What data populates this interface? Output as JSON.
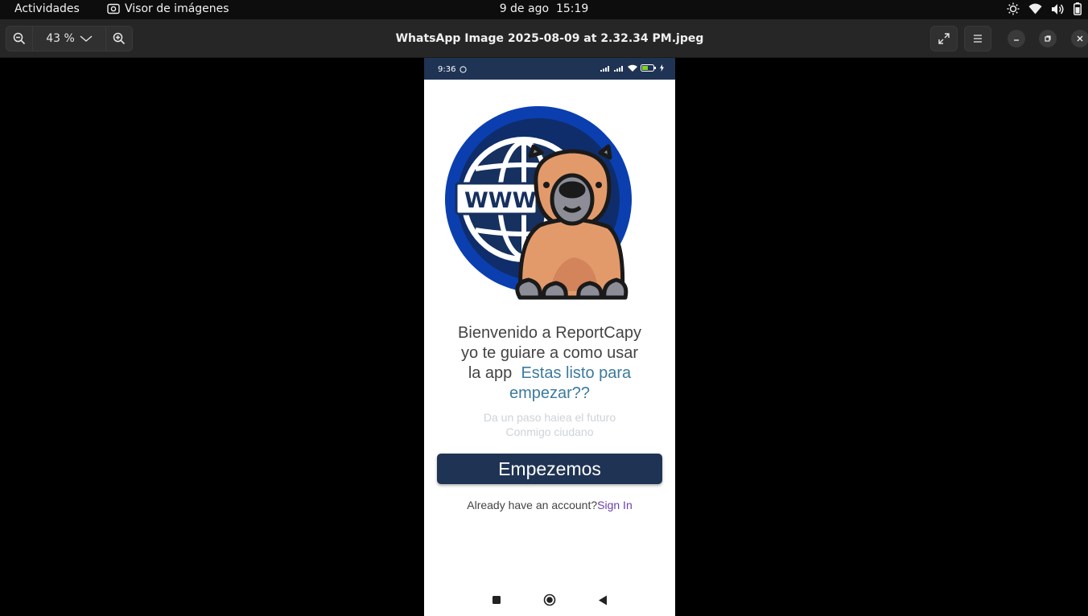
{
  "topbar": {
    "activities": "Actividades",
    "app_name": "Visor de imágenes",
    "date": "9 de ago",
    "time": "15:19",
    "tray_icons": [
      "night-light-icon",
      "wifi-icon",
      "volume-icon",
      "battery-icon"
    ]
  },
  "headerbar": {
    "zoom_level": "43 %",
    "title": "WhatsApp Image 2025-08-09 at 2.32.34 PM.jpeg"
  },
  "phone": {
    "status_time": "9:36",
    "welcome_line1": "Bienvenido a ReportCapy",
    "welcome_line2": "yo te guiare a como usar",
    "welcome_line3": "la app",
    "welcome_accent": "Estas listo para empezar??",
    "sub_line1": "Da un paso haiea el futuro",
    "sub_line2": "Conmigo ciudano",
    "start_button": "Empezemos",
    "account_prompt": "Already have an account?",
    "signin_link": "Sign In",
    "logo_text": "WWW"
  },
  "colors": {
    "phone_header": "#1f3354",
    "accent_text": "#3b7a9e",
    "link": "#6b3fa8",
    "globe_blue": "#0b3fb0"
  }
}
